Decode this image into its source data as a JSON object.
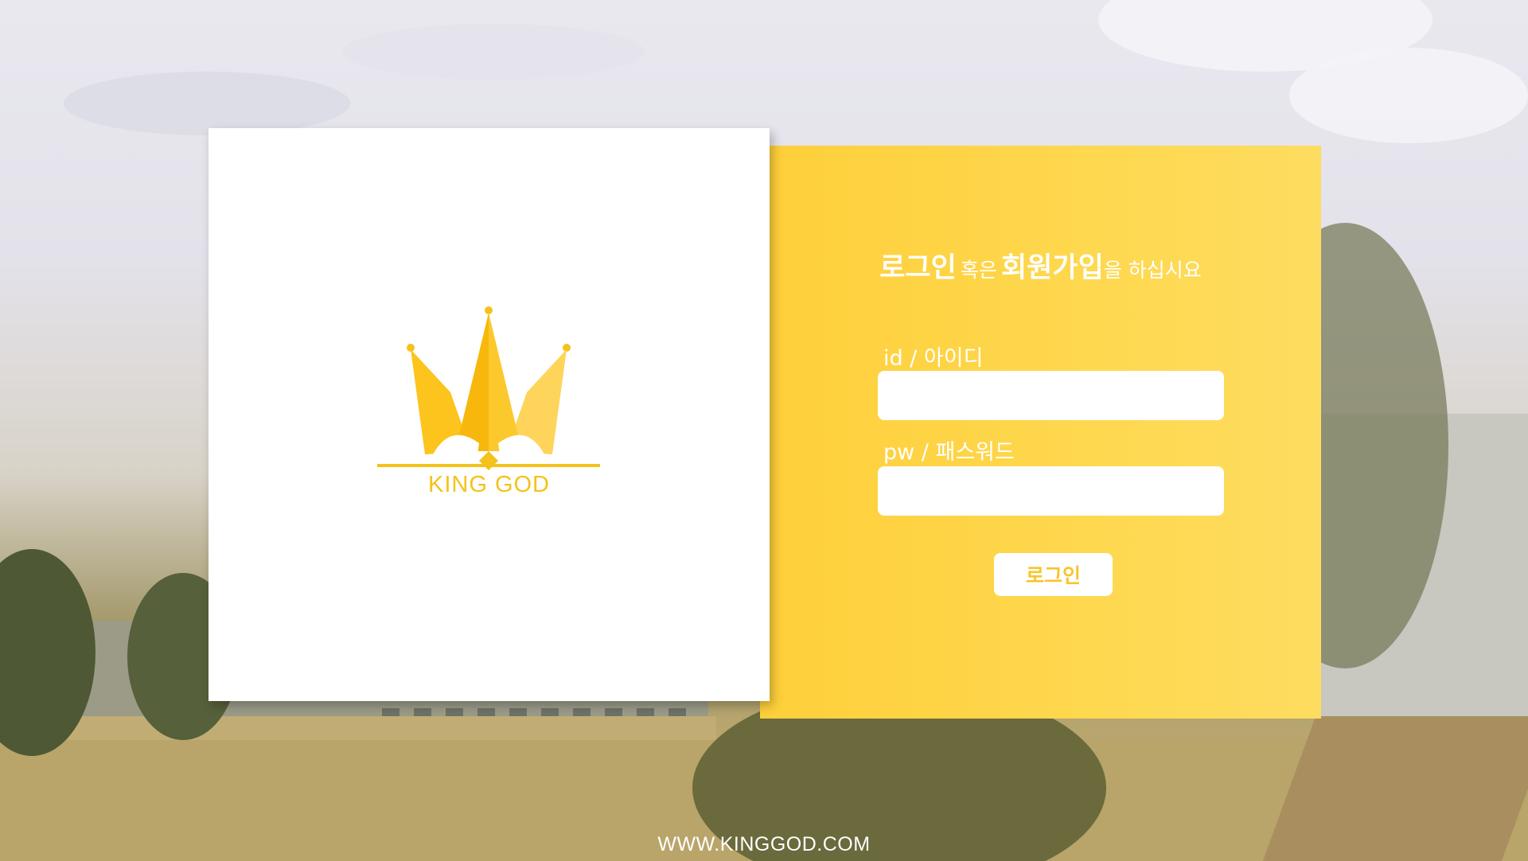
{
  "brand": {
    "logo_icon": "crown-icon",
    "name": "KING GOD",
    "color": "#f5c21b"
  },
  "login": {
    "heading": {
      "login_word": "로그인",
      "or_word": "혹은",
      "signup_word": "회원가입",
      "suffix": "을 하십시요"
    },
    "id_label": "id / 아이디",
    "id_value": "",
    "pw_label": "pw / 패스워드",
    "pw_value": "",
    "button_label": "로그인",
    "panel_color": "#fed448",
    "button_text_color": "#f7c52c"
  },
  "footer": {
    "url": "WWW.KINGGOD.COM"
  }
}
